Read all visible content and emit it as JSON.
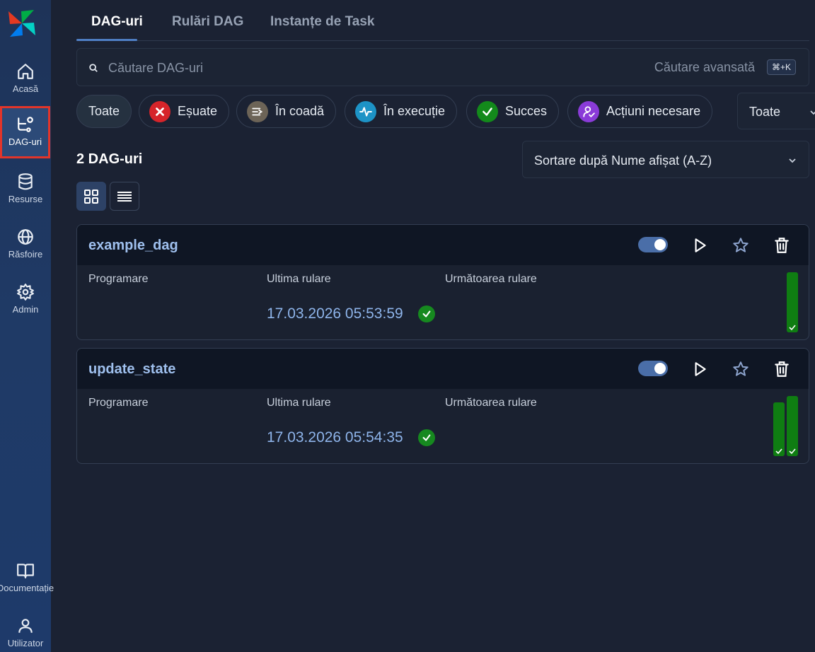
{
  "sidebar": {
    "items": [
      {
        "label": "Acasă",
        "icon": "home-icon"
      },
      {
        "label": "DAG-uri",
        "icon": "dag-icon"
      },
      {
        "label": "Resurse",
        "icon": "database-icon"
      },
      {
        "label": "Răsfoire",
        "icon": "globe-icon"
      },
      {
        "label": "Admin",
        "icon": "gear-icon"
      },
      {
        "label": "Documentație",
        "icon": "book-icon"
      },
      {
        "label": "Utilizator",
        "icon": "user-icon"
      }
    ]
  },
  "tabs": [
    {
      "label": "DAG-uri",
      "active": true
    },
    {
      "label": "Rulări DAG"
    },
    {
      "label": "Instanțe de Task"
    }
  ],
  "search": {
    "placeholder": "Căutare DAG-uri",
    "advanced": "Căutare avansată",
    "shortcut": "⌘+K"
  },
  "filters": {
    "all": "Toate",
    "failed": "Eșuate",
    "queued": "În coadă",
    "running": "În execuție",
    "success": "Succes",
    "actions": "Acțiuni necesare",
    "select_value": "Toate"
  },
  "colors": {
    "failed": "#d6242a",
    "queued": "#6d6457",
    "running": "#1d93c6",
    "success": "#138a1b",
    "actions": "#8a3bd8"
  },
  "list": {
    "count": "2 DAG-uri",
    "sort": "Sortare după Nume afișat (A-Z)"
  },
  "fields": {
    "schedule": "Programare",
    "last_run": "Ultima rulare",
    "next_run": "Următoarea rulare"
  },
  "dags": [
    {
      "name": "example_dag",
      "last_run": "17.03.2026 05:53:59",
      "paused": false,
      "run_states": [
        "success"
      ]
    },
    {
      "name": "update_state",
      "last_run": "17.03.2026 05:54:35",
      "paused": false,
      "run_states": [
        "success",
        "success"
      ]
    }
  ]
}
